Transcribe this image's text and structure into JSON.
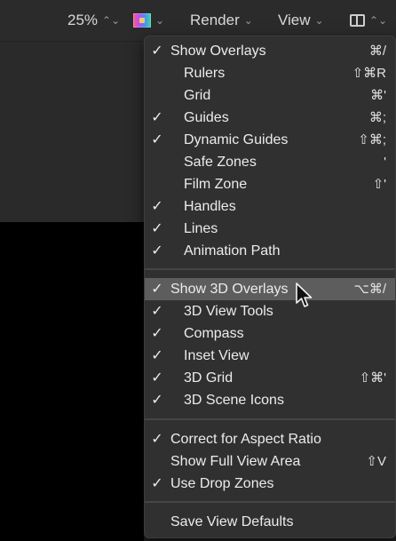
{
  "toolbar": {
    "zoom": "25%",
    "zoom_chevron": "⌃⌄",
    "color_chevron": "⌄",
    "render_label": "Render",
    "render_chevron": "⌄",
    "view_label": "View",
    "view_chevron": "⌄",
    "layout_chevron": "⌃⌄"
  },
  "menu": {
    "section1": [
      {
        "check": "✓",
        "label": "Show Overlays",
        "shortcut": "⌘/"
      },
      {
        "check": "",
        "label": "Rulers",
        "shortcut": "⇧⌘R"
      },
      {
        "check": "",
        "label": "Grid",
        "shortcut": "⌘'"
      },
      {
        "check": "✓",
        "label": "Guides",
        "shortcut": "⌘;"
      },
      {
        "check": "✓",
        "label": "Dynamic Guides",
        "shortcut": "⇧⌘;"
      },
      {
        "check": "",
        "label": "Safe Zones",
        "shortcut": "'"
      },
      {
        "check": "",
        "label": "Film Zone",
        "shortcut": "⇧'"
      },
      {
        "check": "✓",
        "label": "Handles",
        "shortcut": ""
      },
      {
        "check": "✓",
        "label": "Lines",
        "shortcut": ""
      },
      {
        "check": "✓",
        "label": "Animation Path",
        "shortcut": ""
      }
    ],
    "section2": [
      {
        "check": "✓",
        "label": "Show 3D Overlays",
        "shortcut": "⌥⌘/"
      },
      {
        "check": "✓",
        "label": "3D View Tools",
        "shortcut": ""
      },
      {
        "check": "✓",
        "label": "Compass",
        "shortcut": ""
      },
      {
        "check": "✓",
        "label": "Inset View",
        "shortcut": ""
      },
      {
        "check": "✓",
        "label": "3D Grid",
        "shortcut": "⇧⌘'"
      },
      {
        "check": "✓",
        "label": "3D Scene Icons",
        "shortcut": ""
      }
    ],
    "section3": [
      {
        "check": "✓",
        "label": "Correct for Aspect Ratio",
        "shortcut": ""
      },
      {
        "check": "",
        "label": "Show Full View Area",
        "shortcut": "⇧V"
      },
      {
        "check": "✓",
        "label": "Use Drop Zones",
        "shortcut": ""
      }
    ],
    "section4": [
      {
        "check": "",
        "label": "Save View Defaults",
        "shortcut": ""
      }
    ]
  },
  "colors": {
    "menu_bg": "#303030",
    "highlight": "#5d5d5d",
    "toolbar_bg": "#2b2b2b"
  }
}
